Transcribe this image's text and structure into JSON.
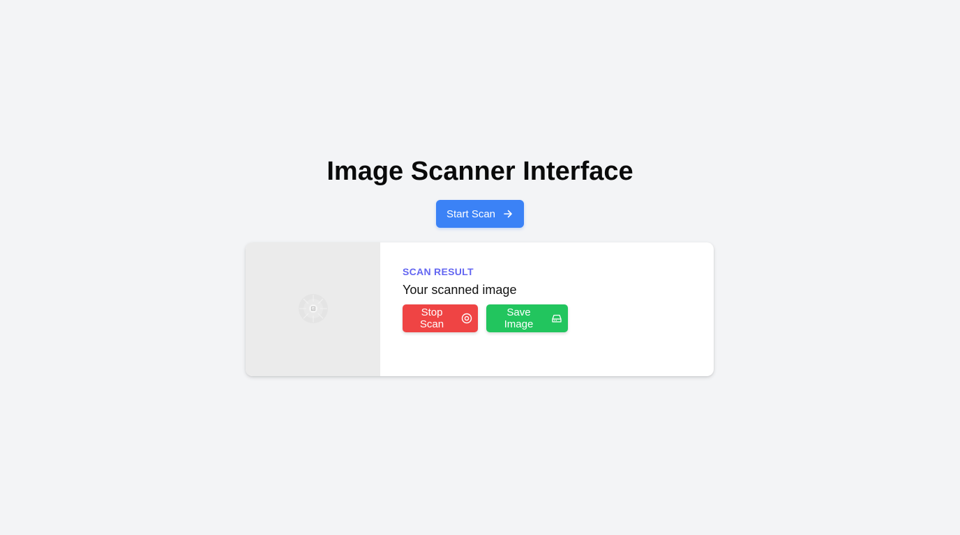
{
  "header": {
    "title": "Image Scanner Interface"
  },
  "toolbar": {
    "start_label": "Start Scan",
    "start_icon": "arrow-right-icon"
  },
  "result": {
    "label": "SCAN RESULT",
    "subtitle": "Your scanned image",
    "image_state": "loading",
    "stop_label": "Stop Scan",
    "stop_icon": "stop-circle-icon",
    "save_label": "Save Image",
    "save_icon": "hard-drive-icon"
  },
  "colors": {
    "background": "#f3f4f6",
    "primary": "#3b82f6",
    "accent_label": "#6366f1",
    "danger": "#ef4444",
    "success": "#22c55e",
    "image_placeholder": "#ebebeb"
  }
}
